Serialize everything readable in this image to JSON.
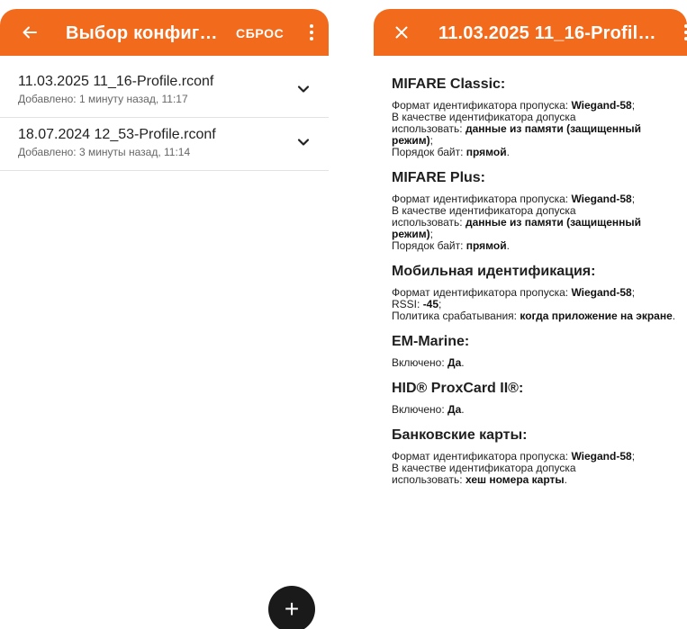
{
  "left": {
    "title": "Выбор конфигурац...",
    "reset_label": "СБРОС",
    "items": [
      {
        "name": "11.03.2025 11_16-Profile.rconf",
        "added": "Добавлено: 1 минуту назад, 11:17"
      },
      {
        "name": "18.07.2024 12_53-Profile.rconf",
        "added": "Добавлено: 3 минуты назад, 11:14"
      }
    ],
    "fab_label": "+"
  },
  "right": {
    "title": "11.03.2025 11_16-Profile.rc...",
    "sections": {
      "mifare_classic": {
        "title": "MIFARE Classic:",
        "l1": "Формат идентификатора пропуска: ",
        "v1": "Wiegand-58",
        "e1": ";",
        "l2a": "В качестве идентификатора допуска",
        "l2b": "использовать: ",
        "v2": "данные из памяти (защищенный режим)",
        "e2": ";",
        "l3": "Порядок байт: ",
        "v3": "прямой",
        "e3": "."
      },
      "mifare_plus": {
        "title": "MIFARE Plus:",
        "l1": "Формат идентификатора пропуска: ",
        "v1": "Wiegand-58",
        "e1": ";",
        "l2a": "В качестве идентификатора допуска",
        "l2b": "использовать: ",
        "v2": "данные из памяти (защищенный режим)",
        "e2": ";",
        "l3": "Порядок байт: ",
        "v3": "прямой",
        "e3": "."
      },
      "mobile": {
        "title": "Мобильная идентификация:",
        "l1": "Формат идентификатора пропуска: ",
        "v1": "Wiegand-58",
        "e1": ";",
        "l2": "RSSI: ",
        "v2": "-45",
        "e2": ";",
        "l3": "Политика срабатывания: ",
        "v3": "когда приложение на экране",
        "e3": "."
      },
      "em_marine": {
        "title": "EM-Marine:",
        "l1": "Включено: ",
        "v1": "Да",
        "e1": "."
      },
      "hid_prox": {
        "title": "HID® ProxCard II®:",
        "l1": "Включено: ",
        "v1": "Да",
        "e1": "."
      },
      "bank_cards": {
        "title": "Банковские карты:",
        "l1": "Формат идентификатора пропуска: ",
        "v1": "Wiegand-58",
        "e1": ";",
        "l2a": "В качестве идентификатора допуска",
        "l2b": "использовать: ",
        "v2": "хеш номера карты",
        "e2": "."
      }
    }
  },
  "colors": {
    "accent": "#f26a1b",
    "fab": "#1a1a1a",
    "divider": "#e2e2e2"
  }
}
